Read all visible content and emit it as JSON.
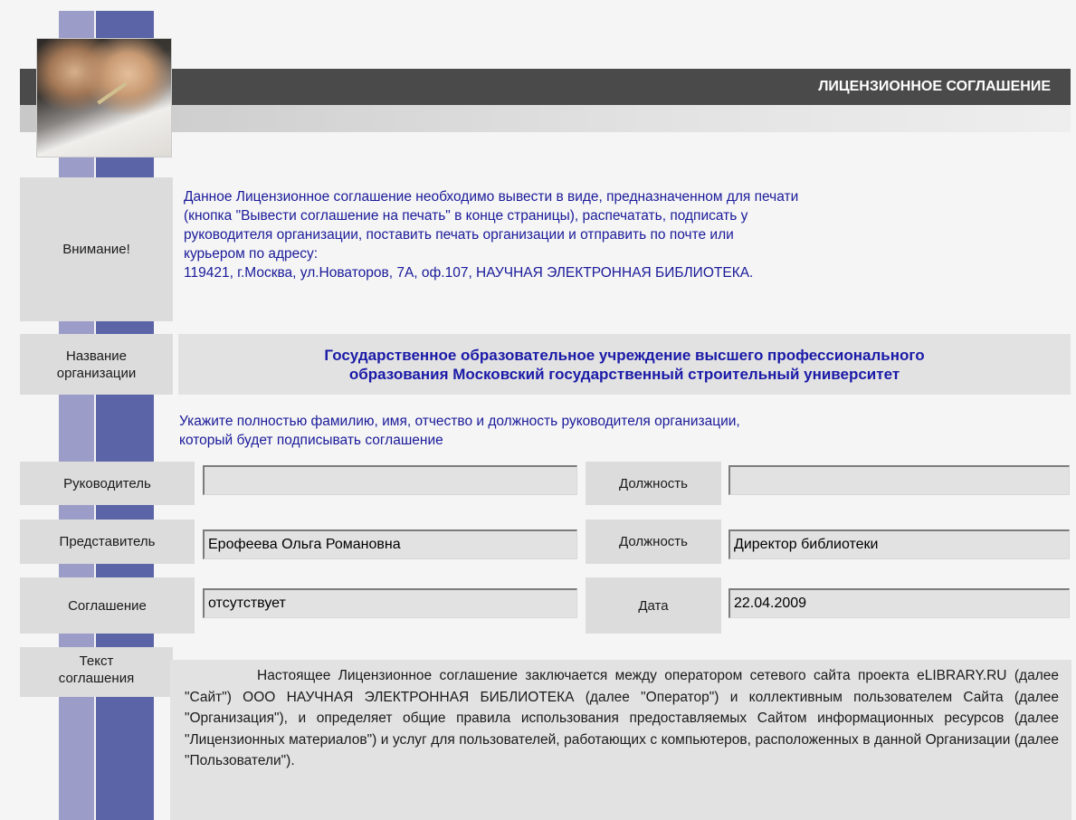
{
  "header": {
    "title": "ЛИЦЕНЗИОННОЕ СОГЛАШЕНИЕ"
  },
  "notice": {
    "label": "Внимание!",
    "lines": [
      "Данное Лицензионное соглашение необходимо вывести в виде, предназначенном для печати",
      "(кнопка \"Вывести соглашение на печать\" в конце страницы), распечатать, подписать у",
      "руководителя организации, поставить печать организации и отправить по почте или",
      "курьером по адресу:",
      "119421, г.Москва, ул.Новаторов, 7А, оф.107, НАУЧНАЯ ЭЛЕКТРОННАЯ БИБЛИОТЕКА."
    ]
  },
  "organization": {
    "label_line1": "Название",
    "label_line2": "организации",
    "name_line1": "Государственное образовательное учреждение высшего профессионального",
    "name_line2": "образования Московский государственный строительный университет"
  },
  "hint": {
    "line1": "Укажите полностью фамилию, имя, отчество и должность руководителя организации,",
    "line2": "который будет подписывать соглашение"
  },
  "form": {
    "head": {
      "label": "Руководитель",
      "value": "",
      "position_label": "Должность",
      "position_value": ""
    },
    "representative": {
      "label": "Представитель",
      "value": "Ерофеева Ольга Романовна",
      "position_label": "Должность",
      "position_value": "Директор библиотеки"
    },
    "agreement": {
      "label": "Соглашение",
      "value": "отсутствует",
      "date_label": "Дата",
      "date_value": "22.04.2009"
    }
  },
  "agreement_text": {
    "label_line1": "Текст",
    "label_line2": "соглашения",
    "body": "Настоящее Лицензионное соглашение заключается между оператором сетевого сайта проекта eLIBRARY.RU (далее \"Сайт\") ООО НАУЧНАЯ ЭЛЕКТРОННАЯ БИБЛИОТЕКА (далее \"Оператор\") и коллективным пользователем Сайта (далее \"Организация\"), и определяет общие правила использования предоставляемых Сайтом информационных ресурсов (далее \"Лицензионных материалов\") и услуг для пользователей, работающих с компьютеров, расположенных в данной Организации (далее \"Пользователи\")."
  },
  "colors": {
    "stripe_light": "#9c9cc8",
    "stripe_dark": "#5a64a6",
    "header_bg": "#4a4a4a",
    "label_bg": "#dcdcdc",
    "info_text": "#1a1a9a",
    "org_text": "#1a1aa8"
  }
}
